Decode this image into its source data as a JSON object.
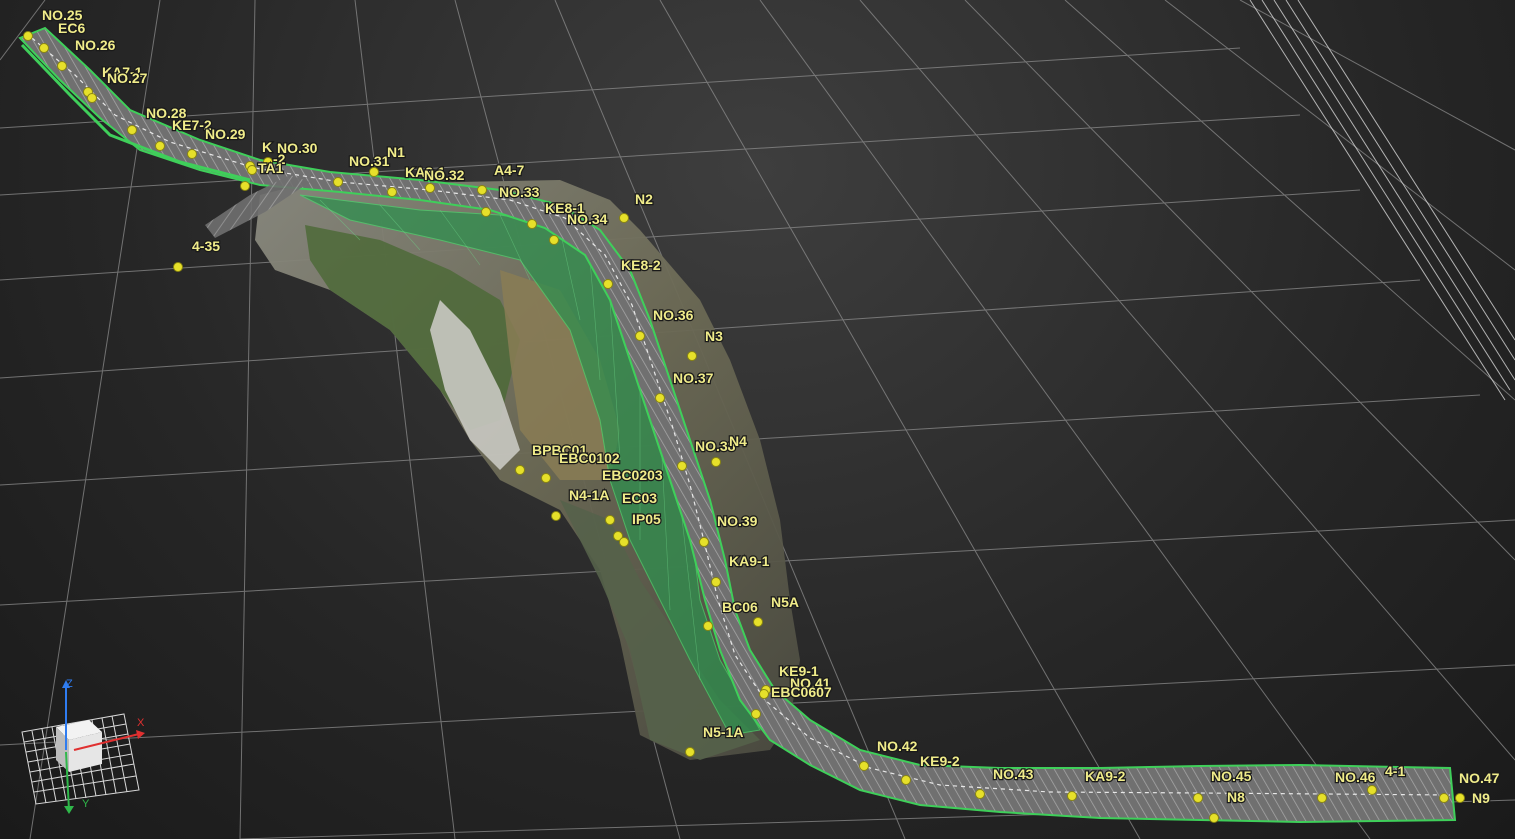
{
  "viewport": {
    "background": "#2b2b2b",
    "grid_color": "#8c8c8c",
    "accent_green": "#3fcf5a",
    "point_color": "#e6e02a"
  },
  "points": [
    {
      "id": "p1",
      "label": "NO.25"
    },
    {
      "id": "p2",
      "label": "EC6"
    },
    {
      "id": "p3",
      "label": "NO.26"
    },
    {
      "id": "p4",
      "label": "KA7-1"
    },
    {
      "id": "p5",
      "label": "NO.27"
    },
    {
      "id": "p6",
      "label": "NO.28"
    },
    {
      "id": "p7",
      "label": "KE7-2"
    },
    {
      "id": "p8",
      "label": "NO.29"
    },
    {
      "id": "p9",
      "label": "NO.30"
    },
    {
      "id": "p10",
      "label": "K"
    },
    {
      "id": "p11",
      "label": "-2"
    },
    {
      "id": "p12",
      "label": "TA1"
    },
    {
      "id": "p13",
      "label": "NO.31"
    },
    {
      "id": "p14",
      "label": "N1"
    },
    {
      "id": "p15",
      "label": "KA8-1"
    },
    {
      "id": "p16",
      "label": "NO.32"
    },
    {
      "id": "p17",
      "label": "A4-7"
    },
    {
      "id": "p18",
      "label": "NO.33"
    },
    {
      "id": "p19",
      "label": "4-35"
    },
    {
      "id": "p20",
      "label": "N2"
    },
    {
      "id": "p21",
      "label": "KE8-1"
    },
    {
      "id": "p22",
      "label": "NO.34"
    },
    {
      "id": "p23",
      "label": "KE8-2"
    },
    {
      "id": "p24",
      "label": "NO.36"
    },
    {
      "id": "p25",
      "label": "N3"
    },
    {
      "id": "p26",
      "label": "NO.37"
    },
    {
      "id": "p27",
      "label": "NO.38"
    },
    {
      "id": "p28",
      "label": "N4"
    },
    {
      "id": "p29",
      "label": "BPBC01"
    },
    {
      "id": "p30",
      "label": "EBC0102"
    },
    {
      "id": "p31",
      "label": "EBC0203"
    },
    {
      "id": "p32",
      "label": "N4-1A"
    },
    {
      "id": "p33",
      "label": "EC03"
    },
    {
      "id": "p34",
      "label": "IP05"
    },
    {
      "id": "p35",
      "label": "NO.39"
    },
    {
      "id": "p36",
      "label": "KA9-1"
    },
    {
      "id": "p37",
      "label": "BC06"
    },
    {
      "id": "p38",
      "label": "N5A"
    },
    {
      "id": "p39",
      "label": "KE9-1"
    },
    {
      "id": "p40",
      "label": "NO.41"
    },
    {
      "id": "p41",
      "label": "EBC0607"
    },
    {
      "id": "p42",
      "label": "N5-1A"
    },
    {
      "id": "p43",
      "label": "NO.42"
    },
    {
      "id": "p44",
      "label": "KE9-2"
    },
    {
      "id": "p45",
      "label": "NO.43"
    },
    {
      "id": "p46",
      "label": "KA9-2"
    },
    {
      "id": "p47",
      "label": "NO.45"
    },
    {
      "id": "p48",
      "label": "N8"
    },
    {
      "id": "p49",
      "label": "NO.46"
    },
    {
      "id": "p50",
      "label": "4-1"
    },
    {
      "id": "p51",
      "label": "NO.47"
    },
    {
      "id": "p52",
      "label": "N9"
    }
  ],
  "gizmo": {
    "axis_z": "Z",
    "axis_x": "X",
    "axis_y": "Y"
  }
}
